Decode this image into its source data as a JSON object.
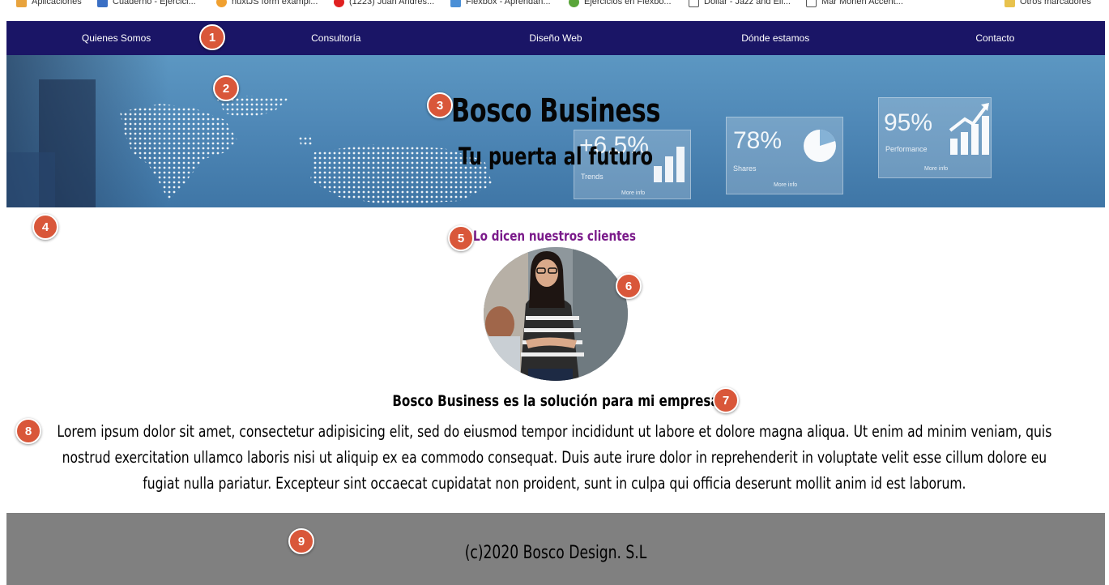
{
  "bookmarks": [
    {
      "label": "Aplicaciones",
      "icon": "apps-grid-icon",
      "color": "#e8a33d"
    },
    {
      "label": "Cuaderno - Ejercici...",
      "icon": "notebook-icon",
      "color": "#3a6fc4"
    },
    {
      "label": "nuxtJS form exampl...",
      "icon": "bookmark-orange-icon",
      "color": "#f0a030"
    },
    {
      "label": "(1223) Juan Andrés...",
      "icon": "youtube-icon",
      "color": "#e02020"
    },
    {
      "label": "Flexbox - Aprendan...",
      "icon": "page-icon",
      "color": "#4a8fd6"
    },
    {
      "label": "Ejercicios en Flexbo...",
      "icon": "leaf-icon",
      "color": "#5aa53a"
    },
    {
      "label": "Dollar - Jazz and Ell...",
      "icon": "g-icon",
      "color": "#555555"
    },
    {
      "label": "Mar Monen Accent...",
      "icon": "doc-icon",
      "color": "#555555"
    },
    {
      "label": "Otros marcadores",
      "icon": "folder-icon",
      "color": "#e8c24d"
    }
  ],
  "nav": {
    "items": [
      "Quienes Somos",
      "Consultoría",
      "Diseño Web",
      "Dónde estamos",
      "Contacto"
    ]
  },
  "hero": {
    "title": "Bosco Business",
    "subtitle": "Tu puerta al futuro",
    "cards": [
      {
        "value": "+6.5%",
        "label": "Trends",
        "more": "More info"
      },
      {
        "value": "78%",
        "label": "Shares",
        "more": "More info"
      },
      {
        "value": "95%",
        "label": "Performance",
        "more": "More info"
      }
    ]
  },
  "testimonials": {
    "heading": "Lo dicen nuestros clientes",
    "quote_title": "Bosco Business es la solución para mi empresa",
    "quote_body": "Lorem ipsum dolor sit amet, consectetur adipisicing elit, sed do eiusmod tempor incididunt ut labore et dolore magna aliqua. Ut enim ad minim veniam, quis nostrud exercitation ullamco laboris nisi ut aliquip ex ea commodo consequat. Duis aute irure dolor in reprehenderit in voluptate velit esse cillum dolore eu fugiat nulla pariatur. Excepteur sint occaecat cupidatat non proident, sunt in culpa qui officia deserunt mollit anim id est laborum."
  },
  "footer": {
    "text": "(c)2020 Bosco Design. S.L"
  },
  "markers": [
    "1",
    "2",
    "3",
    "4",
    "5",
    "6",
    "7",
    "8",
    "9"
  ],
  "colors": {
    "nav_bg": "#1a1566",
    "heading_purple": "#7a1a8a",
    "footer_bg": "#808080",
    "marker": "#d9573a"
  }
}
